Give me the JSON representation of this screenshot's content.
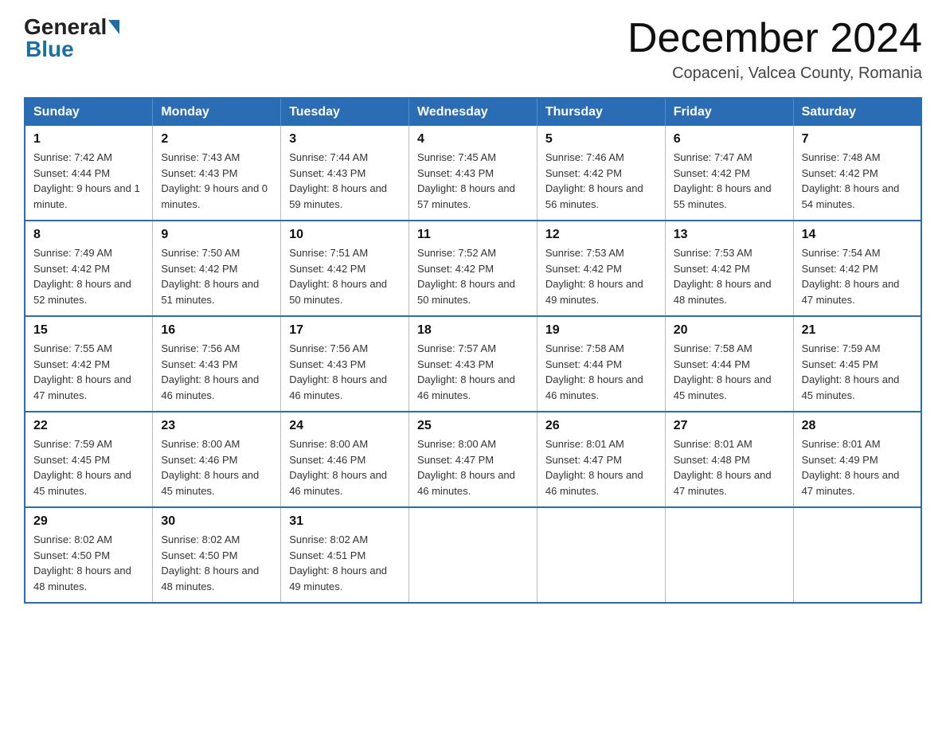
{
  "logo": {
    "part1": "General",
    "part2": "Blue"
  },
  "title": {
    "month": "December 2024",
    "location": "Copaceni, Valcea County, Romania"
  },
  "days_of_week": [
    "Sunday",
    "Monday",
    "Tuesday",
    "Wednesday",
    "Thursday",
    "Friday",
    "Saturday"
  ],
  "weeks": [
    [
      {
        "day": "1",
        "sunrise": "7:42 AM",
        "sunset": "4:44 PM",
        "daylight": "9 hours and 1 minute."
      },
      {
        "day": "2",
        "sunrise": "7:43 AM",
        "sunset": "4:43 PM",
        "daylight": "9 hours and 0 minutes."
      },
      {
        "day": "3",
        "sunrise": "7:44 AM",
        "sunset": "4:43 PM",
        "daylight": "8 hours and 59 minutes."
      },
      {
        "day": "4",
        "sunrise": "7:45 AM",
        "sunset": "4:43 PM",
        "daylight": "8 hours and 57 minutes."
      },
      {
        "day": "5",
        "sunrise": "7:46 AM",
        "sunset": "4:42 PM",
        "daylight": "8 hours and 56 minutes."
      },
      {
        "day": "6",
        "sunrise": "7:47 AM",
        "sunset": "4:42 PM",
        "daylight": "8 hours and 55 minutes."
      },
      {
        "day": "7",
        "sunrise": "7:48 AM",
        "sunset": "4:42 PM",
        "daylight": "8 hours and 54 minutes."
      }
    ],
    [
      {
        "day": "8",
        "sunrise": "7:49 AM",
        "sunset": "4:42 PM",
        "daylight": "8 hours and 52 minutes."
      },
      {
        "day": "9",
        "sunrise": "7:50 AM",
        "sunset": "4:42 PM",
        "daylight": "8 hours and 51 minutes."
      },
      {
        "day": "10",
        "sunrise": "7:51 AM",
        "sunset": "4:42 PM",
        "daylight": "8 hours and 50 minutes."
      },
      {
        "day": "11",
        "sunrise": "7:52 AM",
        "sunset": "4:42 PM",
        "daylight": "8 hours and 50 minutes."
      },
      {
        "day": "12",
        "sunrise": "7:53 AM",
        "sunset": "4:42 PM",
        "daylight": "8 hours and 49 minutes."
      },
      {
        "day": "13",
        "sunrise": "7:53 AM",
        "sunset": "4:42 PM",
        "daylight": "8 hours and 48 minutes."
      },
      {
        "day": "14",
        "sunrise": "7:54 AM",
        "sunset": "4:42 PM",
        "daylight": "8 hours and 47 minutes."
      }
    ],
    [
      {
        "day": "15",
        "sunrise": "7:55 AM",
        "sunset": "4:42 PM",
        "daylight": "8 hours and 47 minutes."
      },
      {
        "day": "16",
        "sunrise": "7:56 AM",
        "sunset": "4:43 PM",
        "daylight": "8 hours and 46 minutes."
      },
      {
        "day": "17",
        "sunrise": "7:56 AM",
        "sunset": "4:43 PM",
        "daylight": "8 hours and 46 minutes."
      },
      {
        "day": "18",
        "sunrise": "7:57 AM",
        "sunset": "4:43 PM",
        "daylight": "8 hours and 46 minutes."
      },
      {
        "day": "19",
        "sunrise": "7:58 AM",
        "sunset": "4:44 PM",
        "daylight": "8 hours and 46 minutes."
      },
      {
        "day": "20",
        "sunrise": "7:58 AM",
        "sunset": "4:44 PM",
        "daylight": "8 hours and 45 minutes."
      },
      {
        "day": "21",
        "sunrise": "7:59 AM",
        "sunset": "4:45 PM",
        "daylight": "8 hours and 45 minutes."
      }
    ],
    [
      {
        "day": "22",
        "sunrise": "7:59 AM",
        "sunset": "4:45 PM",
        "daylight": "8 hours and 45 minutes."
      },
      {
        "day": "23",
        "sunrise": "8:00 AM",
        "sunset": "4:46 PM",
        "daylight": "8 hours and 45 minutes."
      },
      {
        "day": "24",
        "sunrise": "8:00 AM",
        "sunset": "4:46 PM",
        "daylight": "8 hours and 46 minutes."
      },
      {
        "day": "25",
        "sunrise": "8:00 AM",
        "sunset": "4:47 PM",
        "daylight": "8 hours and 46 minutes."
      },
      {
        "day": "26",
        "sunrise": "8:01 AM",
        "sunset": "4:47 PM",
        "daylight": "8 hours and 46 minutes."
      },
      {
        "day": "27",
        "sunrise": "8:01 AM",
        "sunset": "4:48 PM",
        "daylight": "8 hours and 47 minutes."
      },
      {
        "day": "28",
        "sunrise": "8:01 AM",
        "sunset": "4:49 PM",
        "daylight": "8 hours and 47 minutes."
      }
    ],
    [
      {
        "day": "29",
        "sunrise": "8:02 AM",
        "sunset": "4:50 PM",
        "daylight": "8 hours and 48 minutes."
      },
      {
        "day": "30",
        "sunrise": "8:02 AM",
        "sunset": "4:50 PM",
        "daylight": "8 hours and 48 minutes."
      },
      {
        "day": "31",
        "sunrise": "8:02 AM",
        "sunset": "4:51 PM",
        "daylight": "8 hours and 49 minutes."
      },
      null,
      null,
      null,
      null
    ]
  ],
  "labels": {
    "sunrise": "Sunrise:",
    "sunset": "Sunset:",
    "daylight": "Daylight:"
  }
}
